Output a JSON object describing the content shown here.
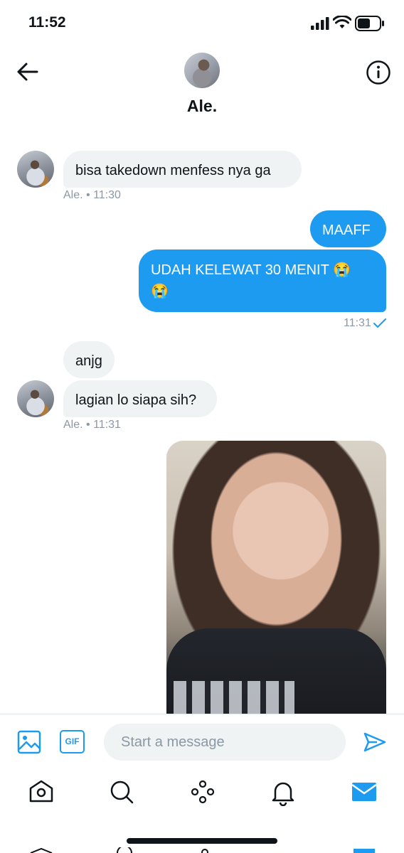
{
  "status_bar": {
    "time": "11:52",
    "icons": [
      "cellular-signal-icon",
      "wifi-icon",
      "battery-icon"
    ]
  },
  "header": {
    "contact_name": "Ale.",
    "back_icon": "arrow-left-icon",
    "info_icon": "info-circle-icon"
  },
  "messages": [
    {
      "side": "in",
      "text": "bisa takedown menfess nya ga",
      "meta": "Ale. • 11:30"
    },
    {
      "side": "out",
      "text": "MAAFF"
    },
    {
      "side": "out",
      "text_line1": "UDAH KELEWAT 30 MENIT 😭",
      "text_line2": "😭",
      "meta": "11:31"
    },
    {
      "side": "in",
      "text": "anjg"
    },
    {
      "side": "in",
      "text": "lagian lo siapa sih?",
      "meta": "Ale. • 11:31"
    },
    {
      "side": "out",
      "type": "image"
    }
  ],
  "composer": {
    "placeholder": "Start a message",
    "gif_label": "GIF",
    "image_icon": "image-icon",
    "send_icon": "send-icon"
  },
  "tabbar": {
    "items": [
      "home-icon",
      "search-icon",
      "spaces-icon",
      "notifications-icon",
      "messages-icon"
    ],
    "active": "messages-icon"
  },
  "colors": {
    "accent": "#1d9bf0",
    "incoming_bubble": "#eff3f4",
    "meta_text": "#8b98a5",
    "text": "#0f1419"
  }
}
